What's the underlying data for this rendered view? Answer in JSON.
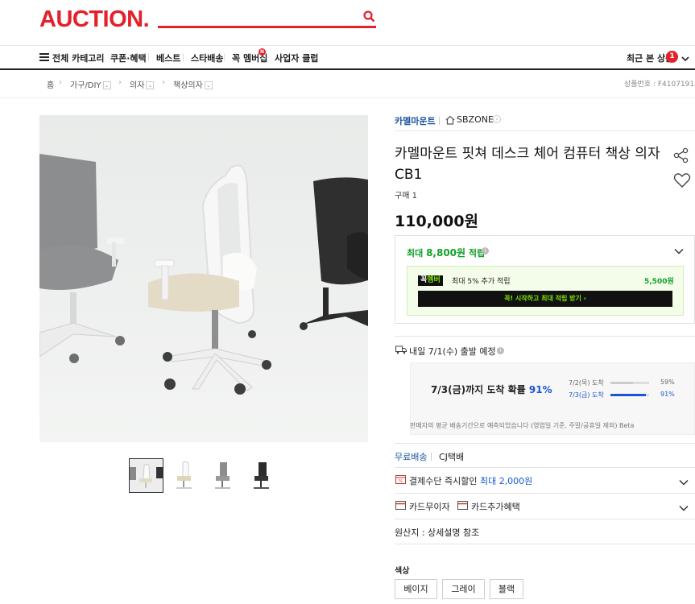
{
  "header": {
    "logo": "AUCTION.",
    "search_placeholder": ""
  },
  "nav": {
    "all_categories": "전체 카테고리",
    "items": [
      "쿠폰·혜택",
      "베스트",
      "스타배송",
      "꼭 멤버십",
      "사업자 클럽"
    ],
    "recent": "최근 본 상품",
    "recent_count": "1"
  },
  "breadcrumb": {
    "items": [
      "홈",
      "가구/DIY",
      "의자",
      "책상의자"
    ],
    "product_id": "상품번호 : F410719187"
  },
  "seller": {
    "brand": "카멜마운트",
    "store": "SBZONE"
  },
  "product": {
    "title": "카멜마운트 핏쳐 데스크 체어 컴퓨터 책상 의자 CB1",
    "sold": "구매 1",
    "price": "110,000원"
  },
  "reward": {
    "prefix": "최대 ",
    "amount": "8,800원",
    "suffix": " 적립",
    "member_badge_a": "꼭",
    "member_badge_b": "멤버",
    "member_text": "최대 5% 추가 적립",
    "member_amount": "5,500원",
    "member_button": "꼭! 시작하고 최대 적립 받기 ›"
  },
  "shipping": {
    "schedule": "내일 7/1(수) 출발 예정",
    "arrival_prefix": "7/3(금)까지 도착 확률 ",
    "arrival_pct": "91%",
    "rows": [
      {
        "label": "7/2(목) 도착",
        "pct_text": "59%",
        "pct": 0.59,
        "color": "#cccccc",
        "text_color": "#666666"
      },
      {
        "label": "7/3(금) 도착",
        "pct_text": "91%",
        "pct": 0.91,
        "color": "#1a56d6",
        "text_color": "#1a56d6"
      }
    ],
    "notice": "판매자의 평균 배송기간으로 예측되었습니다 (영업일 기준, 주말/공휴일 제외) Beta",
    "free": "무료배송",
    "carrier": "CJ택배"
  },
  "benefits": {
    "discount_prefix": "결제수단 즉시할인 ",
    "discount_amount": "최대 2,000원",
    "card_installment": "카드무이자",
    "card_extra": "카드추가혜택"
  },
  "origin": "원산지 : 상세설명 참조",
  "options": {
    "label": "색상",
    "values": [
      "베이지",
      "그레이",
      "블랙"
    ]
  },
  "colors": {
    "brand": "#e4202a",
    "link": "#1a56a0",
    "reward": "#12a12a",
    "member": "#7ce300"
  }
}
